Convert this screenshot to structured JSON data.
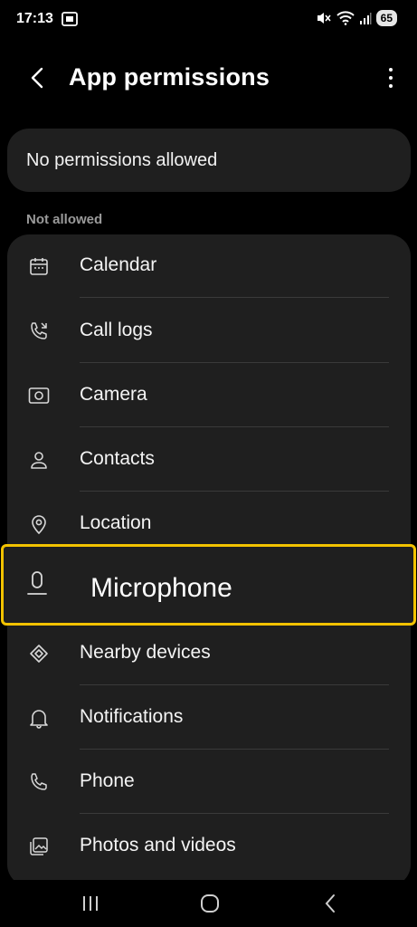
{
  "status_bar": {
    "time": "17:13",
    "battery": "65"
  },
  "header": {
    "title": "App permissions"
  },
  "summary": {
    "text": "No permissions allowed"
  },
  "section": {
    "label": "Not allowed"
  },
  "permissions": [
    {
      "label": "Calendar",
      "icon": "calendar-icon"
    },
    {
      "label": "Call logs",
      "icon": "call-log-icon"
    },
    {
      "label": "Camera",
      "icon": "camera-icon"
    },
    {
      "label": "Contacts",
      "icon": "contacts-icon"
    },
    {
      "label": "Location",
      "icon": "location-icon"
    },
    {
      "label": "Microphone",
      "icon": "microphone-icon"
    },
    {
      "label": "Nearby devices",
      "icon": "nearby-devices-icon"
    },
    {
      "label": "Notifications",
      "icon": "notifications-icon"
    },
    {
      "label": "Phone",
      "icon": "phone-icon"
    },
    {
      "label": "Photos and videos",
      "icon": "photos-icon"
    }
  ],
  "colors": {
    "highlight": "#f2c200",
    "card": "#1f1f1f",
    "background": "#000000"
  }
}
